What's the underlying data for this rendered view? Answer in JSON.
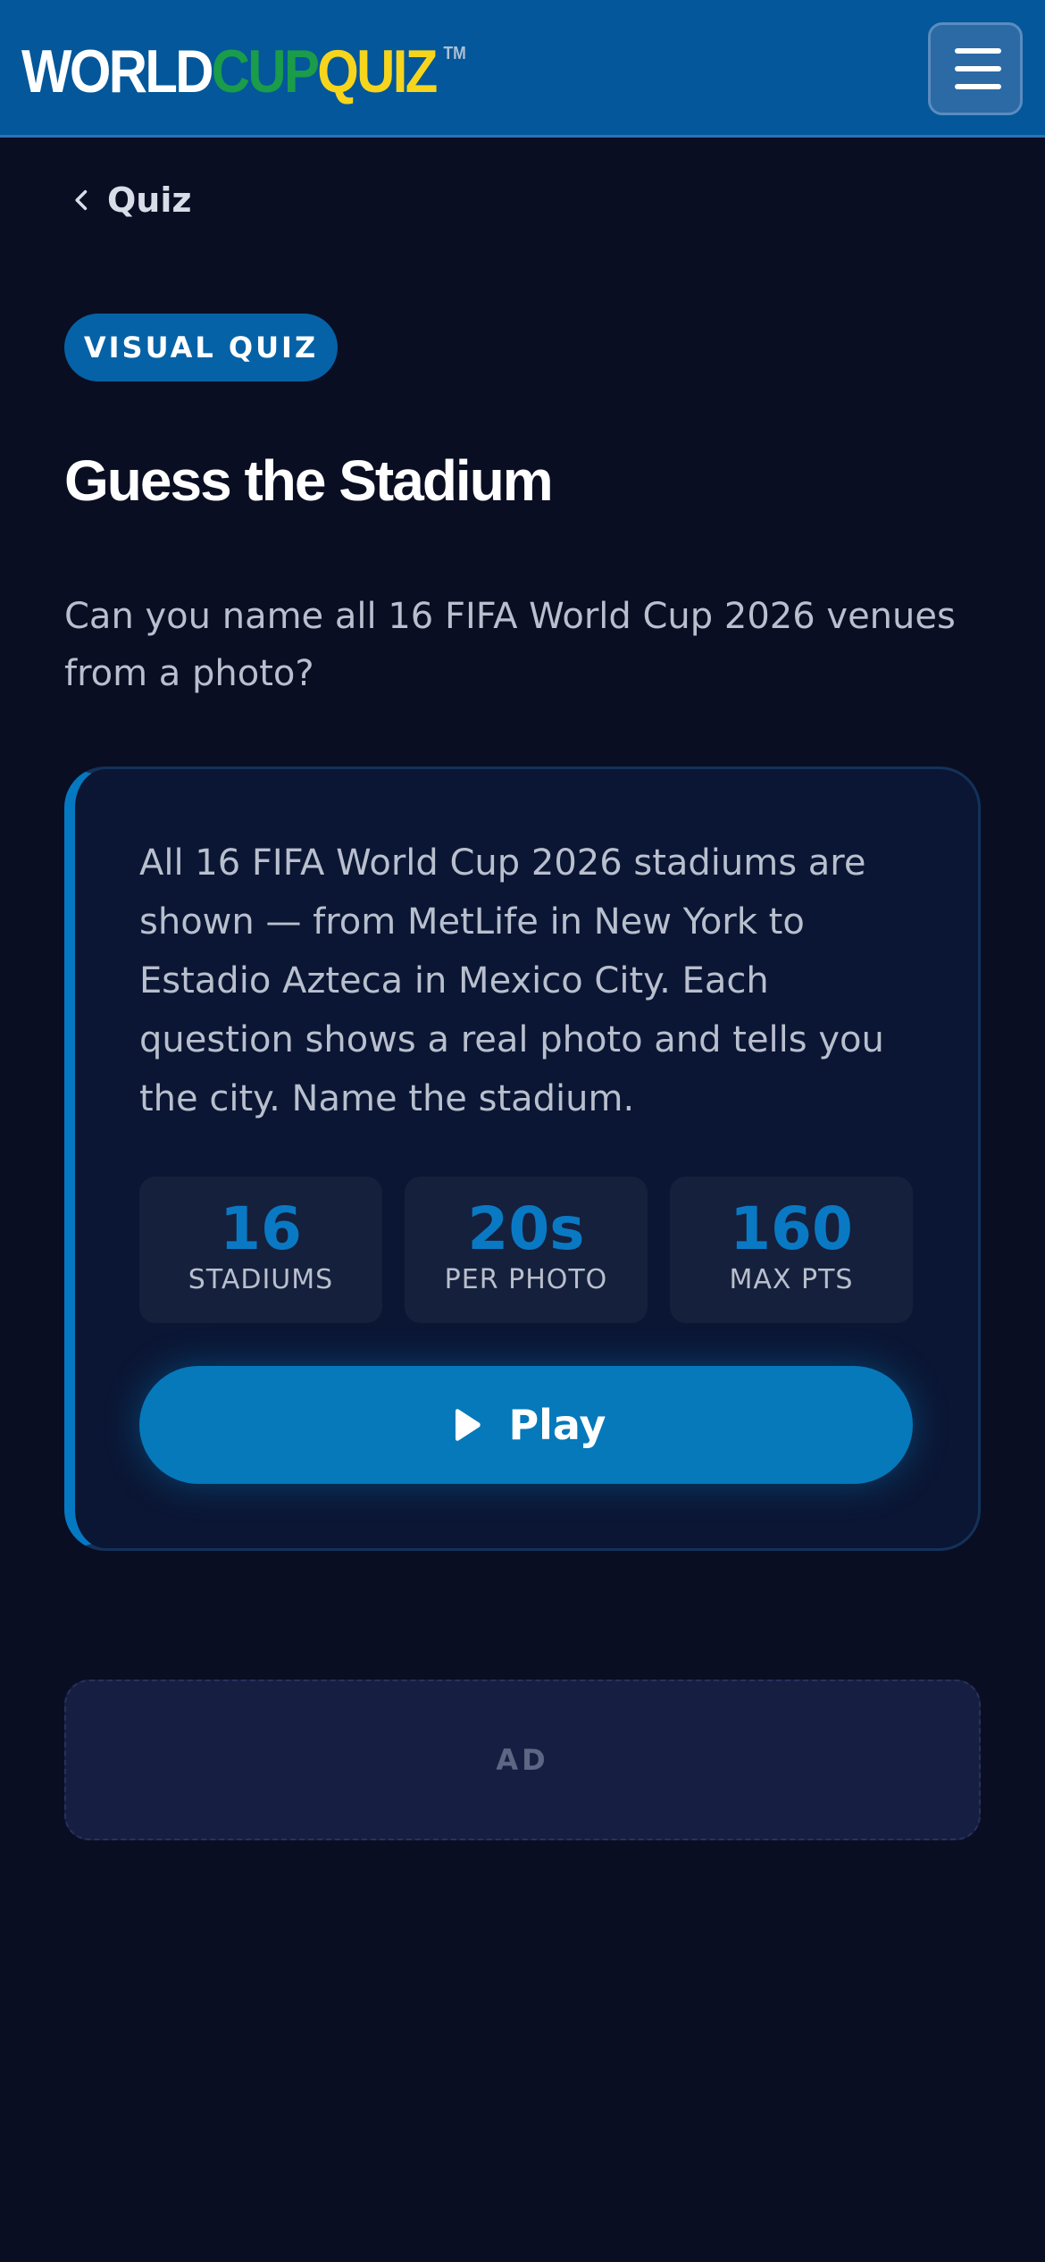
{
  "header": {
    "logo": {
      "part1": "WORLD",
      "part2": "CUP",
      "part3": "QUIZ",
      "tm": "TM",
      "colors": {
        "part1": "#ffffff",
        "part2": "#1a9c4a",
        "part3": "#f7d51d"
      }
    },
    "menu_icon": "hamburger-menu-icon",
    "background": "#03579a"
  },
  "nav": {
    "back_icon": "chevron-left-icon",
    "back_label": "Quiz"
  },
  "badge": "VISUAL QUIZ",
  "title": "Guess the Stadium",
  "subtitle": "Can you name all 16 FIFA World Cup 2026 venues from a photo?",
  "card": {
    "description": "All 16 FIFA World Cup 2026 stadiums are shown — from MetLife in New York to Estadio Azteca in Mexico City. Each question shows a real photo and tells you the city. Name the stadium.",
    "stats": [
      {
        "value": "16",
        "label": "STADIUMS"
      },
      {
        "value": "20s",
        "label": "PER PHOTO"
      },
      {
        "value": "160",
        "label": "MAX PTS"
      }
    ],
    "play_icon": "play-icon",
    "play_label": "Play",
    "accent": "#0578c2"
  },
  "ad_label": "AD"
}
